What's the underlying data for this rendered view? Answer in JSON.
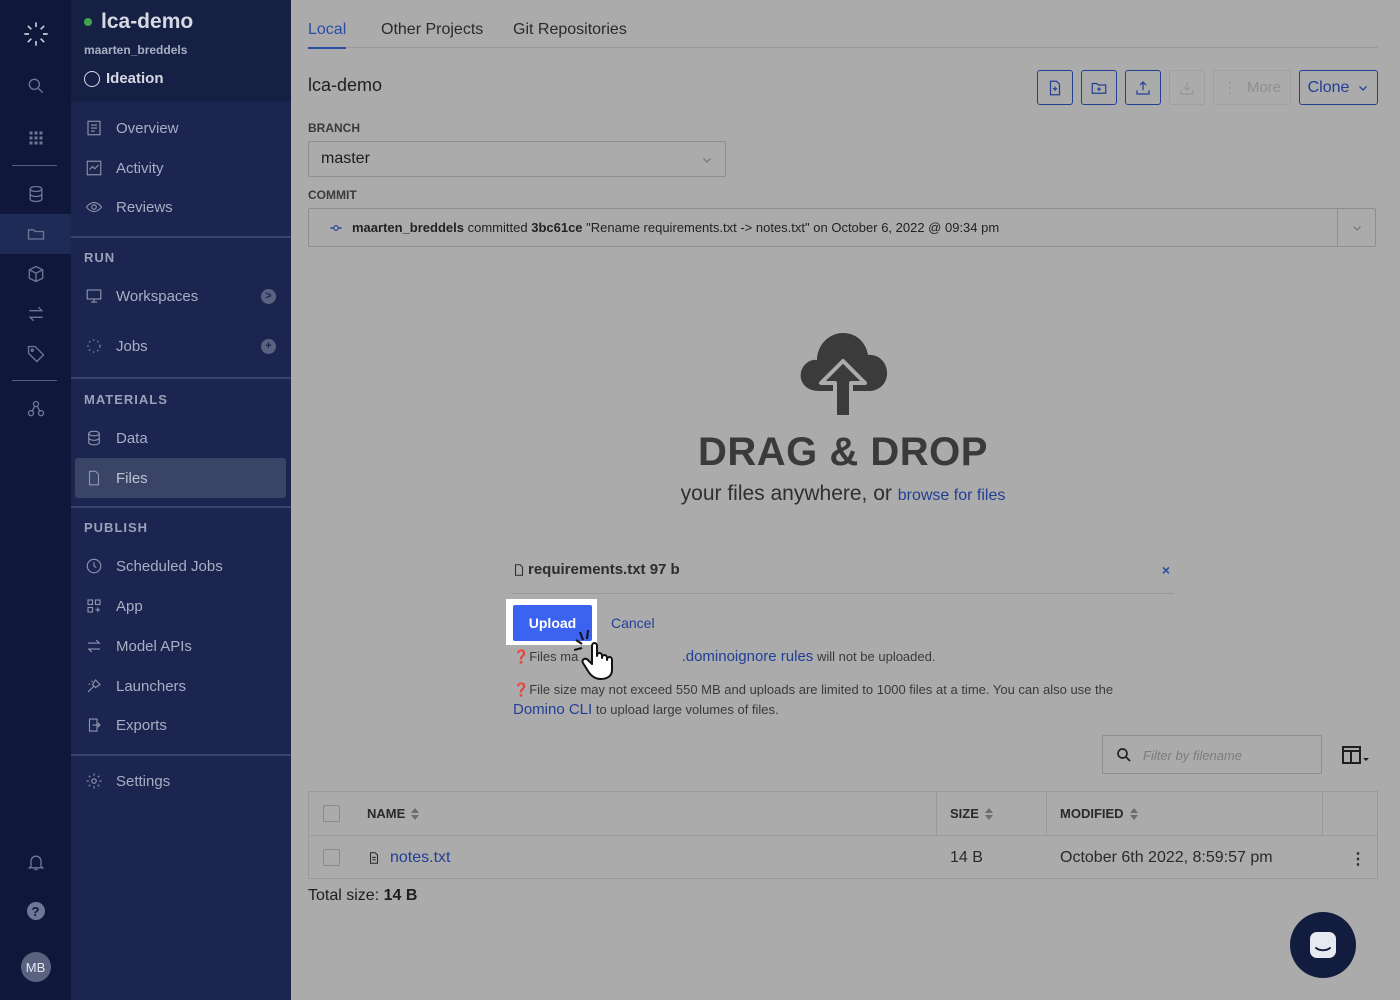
{
  "app": {
    "rail_avatar": "MB"
  },
  "sidebar": {
    "project_name": "lca-demo",
    "project_owner": "maarten_breddels",
    "stage": "Ideation",
    "items_top": [
      {
        "label": "Overview",
        "icon": "overview-icon"
      },
      {
        "label": "Activity",
        "icon": "activity-icon"
      },
      {
        "label": "Reviews",
        "icon": "eye-icon"
      }
    ],
    "section_run": "RUN",
    "items_run": [
      {
        "label": "Workspaces",
        "icon": "monitor-icon",
        "badge": ">"
      },
      {
        "label": "Jobs",
        "icon": "spinner-icon",
        "badge": "+"
      }
    ],
    "section_materials": "MATERIALS",
    "items_materials": [
      {
        "label": "Data",
        "icon": "database-icon"
      },
      {
        "label": "Files",
        "icon": "file-icon"
      }
    ],
    "section_publish": "PUBLISH",
    "items_publish": [
      {
        "label": "Scheduled Jobs",
        "icon": "clock-icon"
      },
      {
        "label": "App",
        "icon": "app-icon"
      },
      {
        "label": "Model APIs",
        "icon": "arrows-icon"
      },
      {
        "label": "Launchers",
        "icon": "launcher-icon"
      },
      {
        "label": "Exports",
        "icon": "export-icon"
      }
    ],
    "settings": "Settings"
  },
  "tabs": {
    "local": "Local",
    "other": "Other Projects",
    "git": "Git Repositories"
  },
  "project_title": "lca-demo",
  "toolbar": {
    "more": "More",
    "clone": "Clone"
  },
  "branch": {
    "label": "BRANCH",
    "value": "master"
  },
  "commit": {
    "label": "COMMIT",
    "author": "maarten_breddels",
    "verb": "committed",
    "hash": "3bc61ce",
    "message": "\"Rename requirements.txt -> notes.txt\"",
    "date": "on October 6, 2022 @ 09:34 pm"
  },
  "dropzone": {
    "title": "DRAG & DROP",
    "subtitle": "your files anywhere, or",
    "browse": "browse for files"
  },
  "pending_file": {
    "name": "requirements.txt 97 b",
    "remove": "×"
  },
  "upload": {
    "upload_label": "Upload",
    "cancel_label": "Cancel"
  },
  "notes": {
    "ignore_prefix": "Files ma",
    "ignore_link": ".dominoignore rules",
    "ignore_suffix": "will not be uploaded.",
    "limit_text": "File size may not exceed 550 MB and uploads are limited to 1000 files at a time. You can also use the",
    "cli_link": "Domino CLI",
    "cli_suffix": "to upload large volumes of files."
  },
  "filter": {
    "placeholder": "Filter by filename"
  },
  "table": {
    "headers": {
      "name": "NAME",
      "size": "SIZE",
      "modified": "MODIFIED"
    },
    "rows": [
      {
        "name": "notes.txt",
        "size": "14 B",
        "modified": "October 6th 2022, 8:59:57 pm"
      }
    ]
  },
  "total": {
    "label": "Total size:",
    "value": "14 B"
  }
}
